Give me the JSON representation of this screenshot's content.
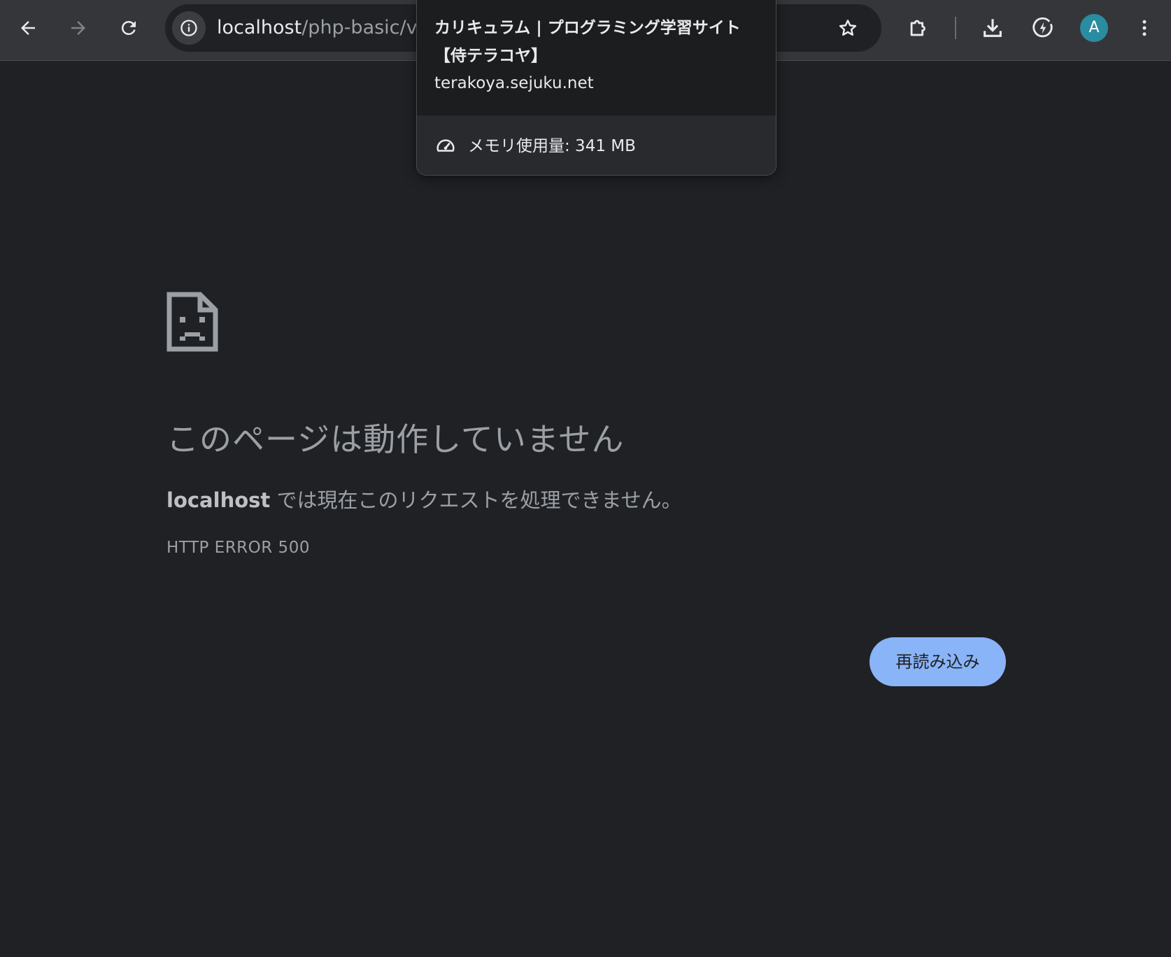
{
  "toolbar": {
    "url_host": "localhost",
    "url_path": "/php-basic/v",
    "avatar_letter": "A"
  },
  "icons": {
    "back": "arrow-left-icon",
    "forward": "arrow-right-icon",
    "reload": "reload-icon",
    "site_info": "info-icon",
    "bookmark": "star-icon",
    "extensions": "puzzle-icon",
    "downloads": "download-icon",
    "performance": "energy-saver-icon",
    "menu": "kebab-menu-icon",
    "memory": "speedometer-icon",
    "error": "sad-file-icon"
  },
  "hovercard": {
    "title": "カリキュラム | プログラミング学習サイト【侍テラコヤ】",
    "domain": "terakoya.sejuku.net",
    "memory": "メモリ使用量: 341 MB"
  },
  "error": {
    "title": "このページは動作していません",
    "host": "localhost",
    "description": " では現在このリクエストを処理できません。",
    "code": "HTTP ERROR 500",
    "reload_label": "再読み込み"
  },
  "colors": {
    "background": "#202124",
    "toolbar": "#35363a",
    "button": "#8ab4f8",
    "avatar": "#2a8ca0"
  }
}
